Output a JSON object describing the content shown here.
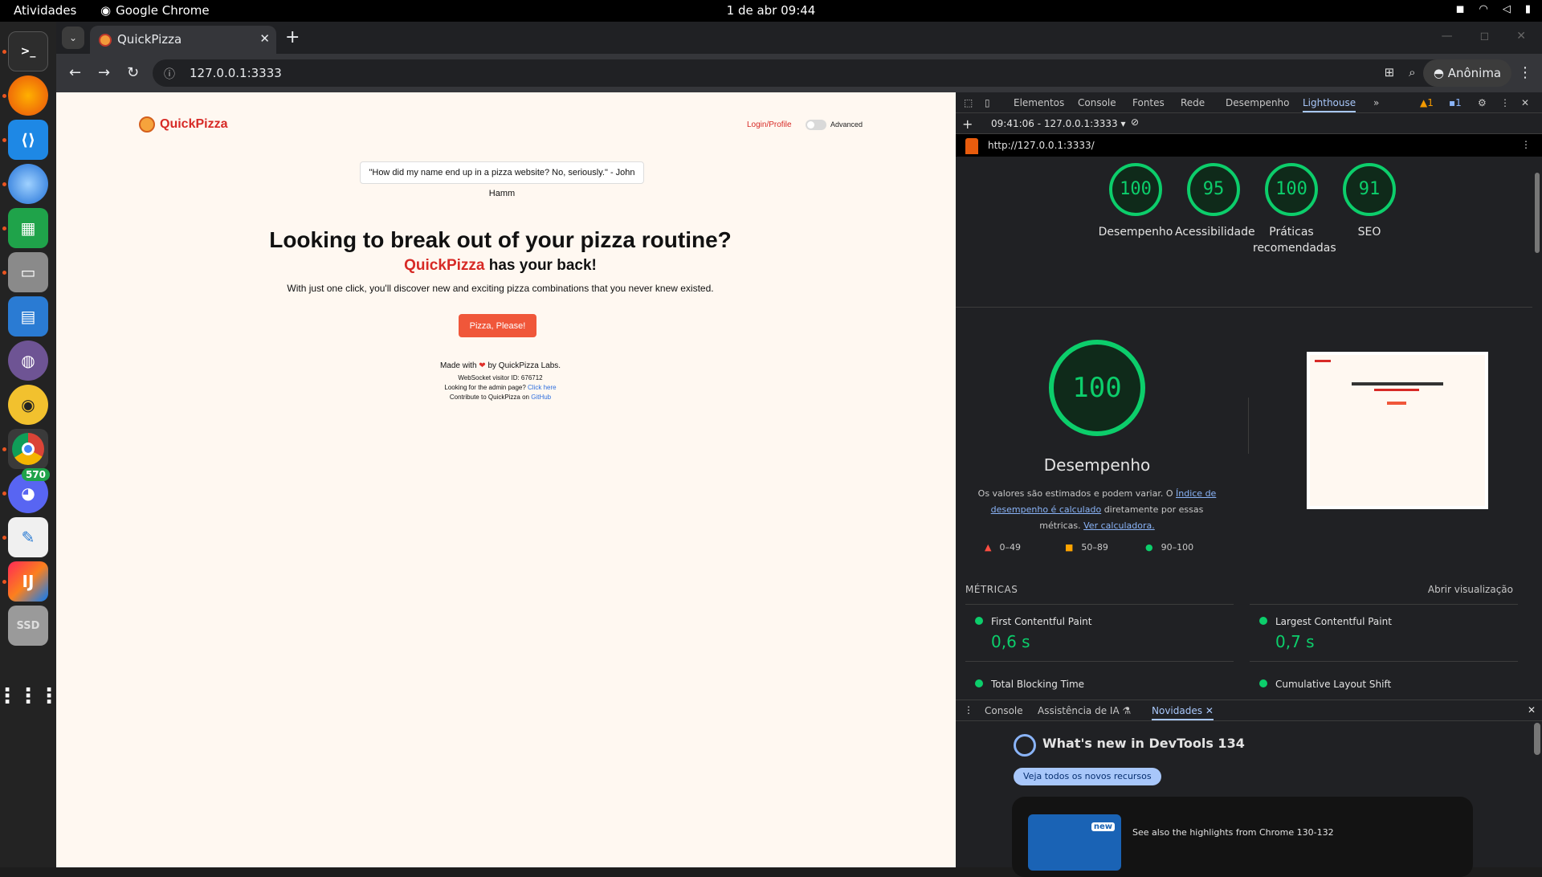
{
  "system": {
    "activities": "Atividades",
    "app_name": "Google Chrome",
    "clock": "1 de abr  09:44"
  },
  "dock": {
    "discord_badge": "570",
    "ssd_label": "SSD"
  },
  "browser": {
    "tab_title": "QuickPizza",
    "url": "127.0.0.1:3333",
    "incognito_label": "Anônima"
  },
  "page": {
    "brand": "QuickPizza",
    "login": "Login/Profile",
    "advanced": "Advanced",
    "quote": "\"How did my name end up in a pizza website? No, seriously.\" - John Hamm",
    "heading": "Looking to break out of your pizza routine?",
    "subheading_brand": "QuickPizza",
    "subheading_rest": " has your back!",
    "description": "With just one click, you'll discover new and exciting pizza combinations that you never knew existed.",
    "button": "Pizza, Please!",
    "made_with_pre": "Made with ",
    "heart": "❤",
    "made_with_post": " by QuickPizza Labs.",
    "visitor": "WebSocket visitor ID: 676712",
    "admin_pre": "Looking for the admin page? ",
    "admin_link": "Click here",
    "contrib_pre": "Contribute to QuickPizza on ",
    "contrib_link": "GitHub"
  },
  "devtools": {
    "tabs": [
      "Elementos",
      "Console",
      "Fontes",
      "Rede",
      "Desempenho",
      "Lighthouse"
    ],
    "warn_count": "1",
    "msg_count": "1",
    "report_select": "09:41:06 - 127.0.0.1:3333",
    "report_url": "http://127.0.0.1:3333/",
    "scores": [
      {
        "value": "100",
        "label": "Desempenho"
      },
      {
        "value": "95",
        "label": "Acessibilidade"
      },
      {
        "value": "100",
        "label": "Práticas recomendadas"
      },
      {
        "value": "91",
        "label": "SEO"
      }
    ],
    "perf_score": "100",
    "perf_title": "Desempenho",
    "desc_pre": "Os valores são estimados e podem variar. O ",
    "desc_link1": "Índice de desempenho é calculado",
    "desc_mid": " diretamente por essas métricas. ",
    "desc_link2": "Ver calculadora.",
    "legend": [
      "0–49",
      "50–89",
      "90–100"
    ],
    "metrics_title": "MÉTRICAS",
    "metrics_open": "Abrir visualização",
    "metrics": [
      {
        "name": "First Contentful Paint",
        "value": "0,6 s"
      },
      {
        "name": "Largest Contentful Paint",
        "value": "0,7 s"
      },
      {
        "name": "Total Blocking Time",
        "value": ""
      },
      {
        "name": "Cumulative Layout Shift",
        "value": ""
      }
    ],
    "drawer_tabs": [
      "Console",
      "Assistência de IA",
      "Novidades"
    ],
    "whats_new": "What's new in DevTools 134",
    "whats_new_btn": "Veja todos os novos recursos",
    "card_new": "new",
    "card_text": "See also the highlights from Chrome 130-132"
  }
}
